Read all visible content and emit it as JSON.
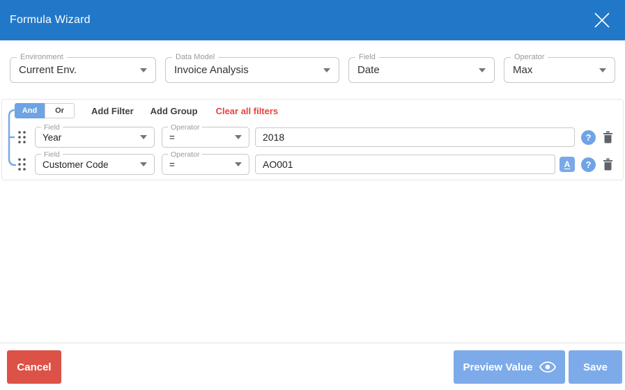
{
  "colors": {
    "header_blue": "#2278c8",
    "accent_blue": "#7aa9e8",
    "toggle_blue": "#6ea3e4",
    "cancel_red": "#dd5247",
    "clear_red": "#e8433e"
  },
  "header": {
    "title": "Formula Wizard"
  },
  "selectors": {
    "environment": {
      "label": "Environment",
      "value": "Current Env."
    },
    "data_model": {
      "label": "Data Model",
      "value": "Invoice Analysis"
    },
    "field": {
      "label": "Field",
      "value": "Date"
    },
    "operator": {
      "label": "Operator",
      "value": "Max"
    }
  },
  "filter_toolbar": {
    "and_label": "And",
    "or_label": "Or",
    "add_filter": "Add Filter",
    "add_group": "Add Group",
    "clear_all": "Clear all filters"
  },
  "filters": {
    "rows": [
      {
        "field_label": "Field",
        "field_value": "Year",
        "operator_label": "Operator",
        "operator_value": "=",
        "value": "2018",
        "help_glyph": "?"
      },
      {
        "field_label": "Field",
        "field_value": "Customer Code",
        "operator_label": "Operator",
        "operator_value": "=",
        "value": "AO001",
        "type_glyph": "A",
        "help_glyph": "?"
      }
    ]
  },
  "footer": {
    "cancel_label": "Cancel",
    "preview_label": "Preview Value",
    "save_label": "Save"
  }
}
